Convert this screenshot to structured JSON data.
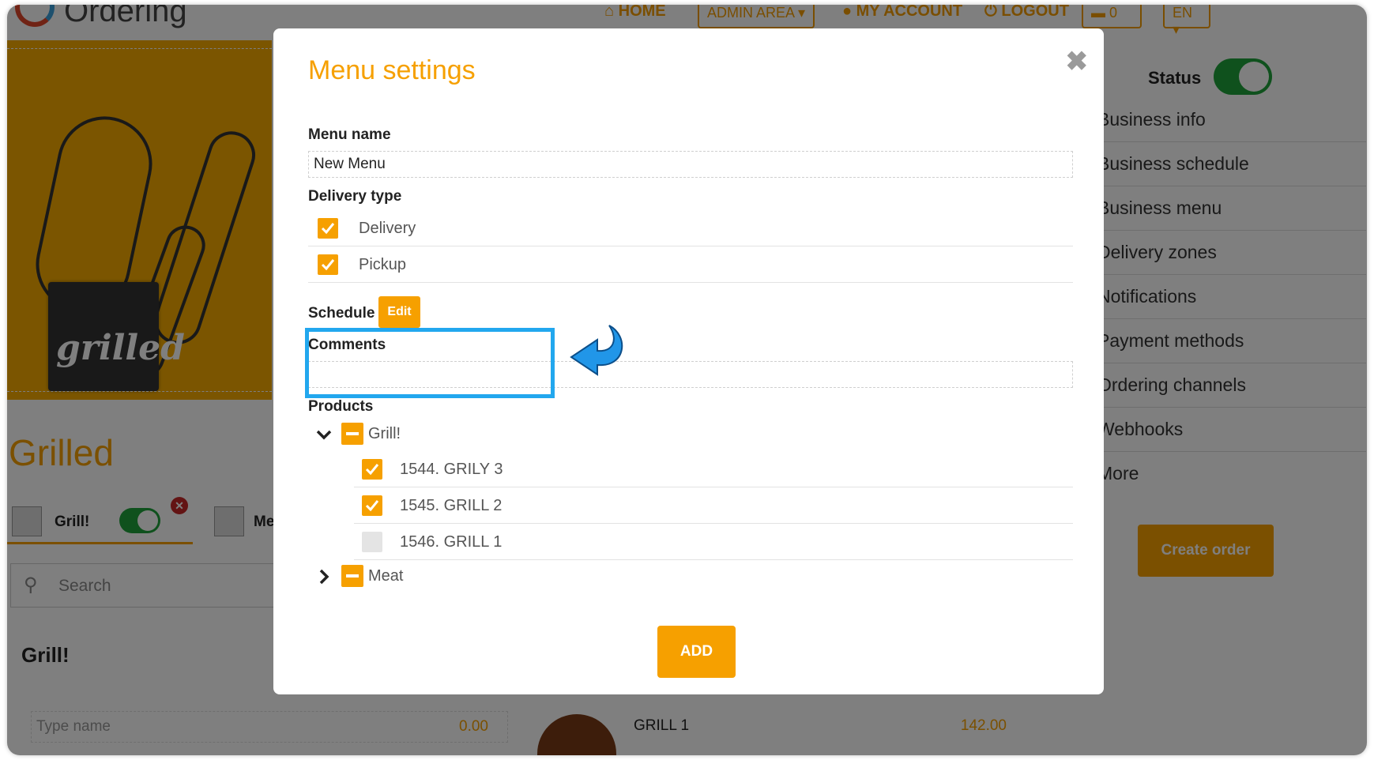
{
  "header": {
    "logo_text": "Ordering",
    "nav": {
      "home": "HOME",
      "admin_area": "ADMIN AREA",
      "my_account": "MY ACCOUNT",
      "logout": "LOGOUT",
      "cart_count": "0",
      "language": "EN"
    }
  },
  "business": {
    "logo_text": "grilled",
    "name": "Grilled",
    "categories": [
      {
        "label": "Grill!",
        "enabled": true
      },
      {
        "label": "Me"
      }
    ],
    "search_placeholder": "Search",
    "section_title": "Grill!",
    "bottom_left": {
      "name_placeholder": "Type name",
      "price": "0.00"
    },
    "bottom_product": {
      "name": "GRILL 1",
      "price": "142.00"
    }
  },
  "sidebar": {
    "status_label": "Status",
    "status_on": true,
    "items": [
      "Business info",
      "Business schedule",
      "Business menu",
      "Delivery zones",
      "Notifications",
      "Payment methods",
      "Ordering channels",
      "Webhooks",
      "More"
    ],
    "create_order": "Create order"
  },
  "modal": {
    "title": "Menu settings",
    "close_symbol": "✖",
    "menu_name_label": "Menu name",
    "menu_name_value": "New Menu",
    "delivery_type_label": "Delivery type",
    "delivery_types": [
      {
        "label": "Delivery",
        "checked": true
      },
      {
        "label": "Pickup",
        "checked": true
      }
    ],
    "schedule_label": "Schedule",
    "edit_label": "Edit",
    "comments_label": "Comments",
    "comments_value": "",
    "products_label": "Products",
    "product_categories": [
      {
        "label": "Grill!",
        "expanded": true,
        "products": [
          {
            "label": "1544. GRILY 3",
            "checked": true
          },
          {
            "label": "1545. GRILL 2",
            "checked": true
          },
          {
            "label": "1546. GRILL 1",
            "checked": false
          }
        ]
      },
      {
        "label": "Meat",
        "expanded": false,
        "products": []
      }
    ],
    "add_label": "ADD"
  },
  "colors": {
    "accent": "#f6a000",
    "toggle_on": "#1fa23a",
    "annotation": "#22a7ee",
    "overlay": "rgba(0,0,0,0.5)"
  }
}
